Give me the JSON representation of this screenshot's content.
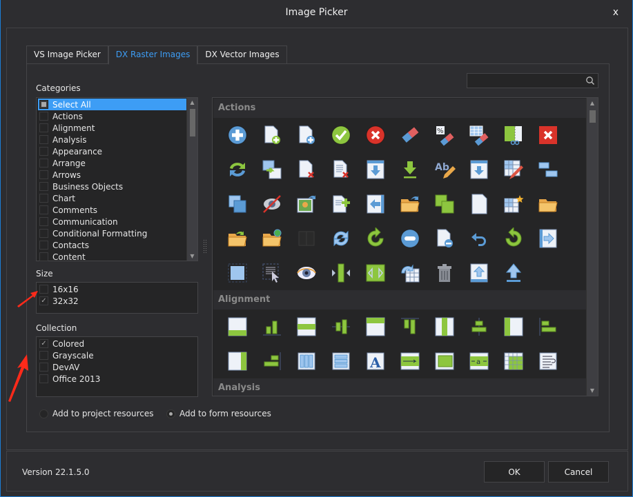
{
  "window": {
    "title": "Image Picker",
    "close_label": "x"
  },
  "tabs": [
    {
      "label": "VS Image Picker",
      "active": false
    },
    {
      "label": "DX Raster Images",
      "active": true
    },
    {
      "label": "DX Vector Images",
      "active": false
    }
  ],
  "categories": {
    "label": "Categories",
    "items": [
      {
        "label": "Select All",
        "selected": true,
        "state": "indeterminate"
      },
      {
        "label": "Actions",
        "state": "unchecked"
      },
      {
        "label": "Alignment",
        "state": "unchecked"
      },
      {
        "label": "Analysis",
        "state": "unchecked"
      },
      {
        "label": "Appearance",
        "state": "unchecked"
      },
      {
        "label": "Arrange",
        "state": "unchecked"
      },
      {
        "label": "Arrows",
        "state": "unchecked"
      },
      {
        "label": "Business Objects",
        "state": "unchecked"
      },
      {
        "label": "Chart",
        "state": "unchecked"
      },
      {
        "label": "Comments",
        "state": "unchecked"
      },
      {
        "label": "Communication",
        "state": "unchecked"
      },
      {
        "label": "Conditional Formatting",
        "state": "unchecked"
      },
      {
        "label": "Contacts",
        "state": "unchecked"
      },
      {
        "label": "Content",
        "state": "unchecked"
      }
    ]
  },
  "size": {
    "label": "Size",
    "items": [
      {
        "label": "16x16",
        "checked": false
      },
      {
        "label": "32x32",
        "checked": true
      }
    ]
  },
  "collection": {
    "label": "Collection",
    "items": [
      {
        "label": "Colored",
        "checked": true
      },
      {
        "label": "Grayscale",
        "checked": false
      },
      {
        "label": "DevAV",
        "checked": false
      },
      {
        "label": "Office 2013",
        "checked": false
      }
    ]
  },
  "resources": {
    "options": [
      {
        "label": "Add to project resources",
        "selected": false
      },
      {
        "label": "Add to form resources",
        "selected": true
      }
    ]
  },
  "search": {
    "value": "",
    "placeholder": ""
  },
  "gallery": {
    "groups": [
      {
        "name": "Actions",
        "rows": [
          [
            "add-circle",
            "new-doc-add",
            "new-doc-blue-add",
            "check-green",
            "cancel-red",
            "eraser",
            "clear-formatting-percent",
            "clear-table",
            "cut-shape",
            "delete-red-square"
          ],
          [
            "refresh-convert",
            "table-move",
            "doc-delete",
            "doc-lines-delete",
            "download-window",
            "download-green",
            "edit-text-ab",
            "download-page",
            "edit-table",
            "align-boxes"
          ],
          [
            "duplicate",
            "hide-eye",
            "image-export",
            "add-text",
            "import-arrow-left",
            "open-folder-share",
            "group-squares",
            "blank-page",
            "new-table-star",
            "folder-open"
          ],
          [
            "folder-open-arrow",
            "folder-web",
            "book-disabled",
            "refresh-blue",
            "redo-green",
            "remove-circle",
            "doc-remove",
            "undo",
            "reset-green",
            "export-arrow-right"
          ],
          [
            "select-square",
            "select-text-cursor",
            "show-eye",
            "split-vertical",
            "stretch-horizontal",
            "table-refresh",
            "trash",
            "upload-page",
            "upload-arrow"
          ]
        ]
      },
      {
        "name": "Alignment",
        "rows": [
          [
            "align-bottom",
            "align-bottom-bars",
            "align-middle",
            "align-middle-bars",
            "align-top",
            "align-top-bars",
            "align-center",
            "align-center-bars",
            "align-left",
            "align-left-bars"
          ],
          [
            "align-right",
            "align-right-bars",
            "columns",
            "rows",
            "font-a",
            "text-direction",
            "cell-fill",
            "text-spacing",
            "table-green",
            "word-wrap"
          ]
        ]
      },
      {
        "name": "Analysis",
        "rows": []
      }
    ]
  },
  "footer": {
    "version": "Version 22.1.5.0",
    "ok_label": "OK",
    "cancel_label": "Cancel"
  },
  "colors": {
    "accent": "#3d9df5",
    "background": "#2d2d30",
    "panel": "#252526",
    "border": "#454548",
    "window_border": "#1c7ed6",
    "annotation": "#ff2a1a"
  }
}
